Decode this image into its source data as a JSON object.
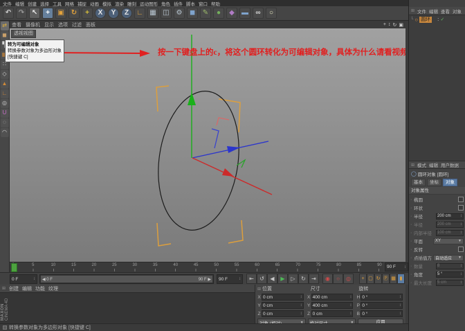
{
  "colors": {
    "axis_x_red": "#cc2a2a",
    "axis_y_green": "#19b019",
    "axis_z_blue": "#2b35cc",
    "selection_bracket_orange": "#dd9f3d",
    "annotation_red": "#e02020",
    "spline_black": "#1c1c1c",
    "active_tab_blue": "#5b7ca3",
    "play_green": "#4ca23e",
    "object_highlight_orange": "#c8873d"
  },
  "menubar": {
    "items": [
      "文件",
      "编辑",
      "创建",
      "选择",
      "工具",
      "网格",
      "捕捉",
      "动画",
      "模拟",
      "渲染",
      "雕刻",
      "运动图形",
      "角色",
      "插件",
      "脚本",
      "窗口",
      "帮助"
    ]
  },
  "toolbar": {
    "buttons": [
      {
        "name": "undo-button",
        "glyph": "↶",
        "color": "#cfcfcf"
      },
      {
        "name": "redo-button",
        "glyph": "↷",
        "color": "#9a9a9a"
      },
      {
        "name": "live-selection-button",
        "glyph": "↖",
        "color": "#f0f0f0",
        "bg": "#5f5f5f"
      },
      {
        "name": "move-button",
        "glyph": "+",
        "color": "#ffffff",
        "bg": "#66809c"
      },
      {
        "name": "scale-button",
        "glyph": "▣",
        "color": "#e2a23c"
      },
      {
        "name": "rotate-button",
        "glyph": "↻",
        "color": "#e2a23c"
      },
      {
        "name": "last-tool-button",
        "glyph": "+",
        "color": "#d8c03a"
      },
      {
        "name": "lock-x-button",
        "glyph": "X",
        "color": "#e8e8e8",
        "round": true
      },
      {
        "name": "lock-y-button",
        "glyph": "Y",
        "color": "#e8e8e8",
        "round": true
      },
      {
        "name": "lock-z-button",
        "glyph": "Z",
        "color": "#e8e8e8",
        "round": true
      },
      {
        "name": "coordinate-system-button",
        "glyph": "∟",
        "color": "#e2a23c"
      },
      {
        "name": "render-view-button",
        "glyph": "▦",
        "color": "#b9c7d2"
      },
      {
        "name": "render-region-button",
        "glyph": "◫",
        "color": "#b9c7d2"
      },
      {
        "name": "render-settings-button",
        "glyph": "⚙",
        "color": "#b9c7d2"
      },
      {
        "name": "primitive-cube-button",
        "glyph": "◼",
        "color": "#7fa3cc"
      },
      {
        "name": "spline-pen-button",
        "glyph": "✎",
        "color": "#9cba6a"
      },
      {
        "name": "subdivision-surface-button",
        "glyph": "●",
        "color": "#74b05c"
      },
      {
        "name": "deformer-button",
        "glyph": "◆",
        "color": "#b07cc5"
      },
      {
        "name": "floor-button",
        "glyph": "▬",
        "color": "#7fa3cc"
      },
      {
        "name": "camera-button",
        "glyph": "∞",
        "color": "#d9d9d9"
      },
      {
        "name": "light-button",
        "glyph": "○",
        "color": "#f3f3c9"
      }
    ]
  },
  "left_toolbar": {
    "buttons": [
      {
        "name": "convert-editable-button",
        "glyph": "⇄",
        "color": "#e2b13c",
        "bg": "#6b6b6b"
      },
      {
        "name": "model-mode-button",
        "glyph": "◼",
        "color": "#c9a06a"
      },
      {
        "name": "texture-mode-button",
        "glyph": "▚",
        "color": "#d8d8d8"
      },
      {
        "name": "workplane-mode-button",
        "glyph": "▦",
        "color": "#cf8a3a"
      },
      {
        "name": "points-mode-button",
        "glyph": "∷",
        "color": "#cfcfcf"
      },
      {
        "name": "edges-mode-button",
        "glyph": "◇",
        "color": "#cfcfcf"
      },
      {
        "name": "polygons-mode-button",
        "glyph": "▲",
        "color": "#cf8a3a"
      },
      {
        "name": "axis-mode-button",
        "glyph": "∟",
        "color": "#cf8a3a"
      },
      {
        "name": "solo-mode-button",
        "glyph": "◎",
        "color": "#cfcfcf"
      },
      {
        "name": "snap-button",
        "glyph": "U",
        "color": "#c86ec8"
      },
      {
        "name": "quantize-button",
        "glyph": "◌",
        "color": "#cfcfcf"
      },
      {
        "name": "workplane-snap-button",
        "glyph": "◠",
        "color": "#cfcfcf"
      }
    ]
  },
  "viewport": {
    "menu_items": [
      "查看",
      "摄像机",
      "显示",
      "选项",
      "过滤",
      "面板"
    ],
    "nav": [
      {
        "name": "pan-view-icon",
        "glyph": "+"
      },
      {
        "name": "zoom-view-icon",
        "glyph": "↕"
      },
      {
        "name": "rotate-view-icon",
        "glyph": "↻"
      },
      {
        "name": "toggle-view-icon",
        "glyph": "▣"
      }
    ],
    "view_label": "透视视图",
    "tooltip": {
      "title": "转为可编辑对象",
      "body": "转换参数对象为多边形对象",
      "shortcut": "[快捷键 C]"
    },
    "annotation": "按一下键盘上的c，将这个圆环转化为可编辑对象，具体为什么请看视频"
  },
  "timeline": {
    "ticks": [
      "0",
      "5",
      "10",
      "15",
      "20",
      "25",
      "30",
      "35",
      "40",
      "45",
      "50",
      "55",
      "60",
      "65",
      "70",
      "75",
      "80",
      "85",
      "90"
    ],
    "end_frame_top": "90 F",
    "current_frame": "0 F",
    "range_start": "0 F",
    "range_end": "90 F",
    "end_frame": "90 F",
    "transport": [
      {
        "name": "goto-start-button",
        "glyph": "⇤"
      },
      {
        "name": "previous-key-button",
        "glyph": "↺"
      },
      {
        "name": "previous-frame-button",
        "glyph": "◀"
      },
      {
        "name": "play-button",
        "glyph": "▶",
        "color": "#4dbb57"
      },
      {
        "name": "next-frame-button",
        "glyph": "▷"
      },
      {
        "name": "next-key-button",
        "glyph": "↻"
      },
      {
        "name": "goto-end-button",
        "glyph": "⇥"
      }
    ],
    "record": [
      {
        "name": "record-keyframe-button",
        "glyph": "◉"
      },
      {
        "name": "autokey-button",
        "glyph": "○"
      },
      {
        "name": "keyframe-selection-button",
        "glyph": "◎"
      }
    ],
    "key_toggles": [
      {
        "name": "key-position-button",
        "glyph": "+"
      },
      {
        "name": "key-scale-button",
        "glyph": "▢"
      },
      {
        "name": "key-rotation-button",
        "glyph": "↻"
      },
      {
        "name": "key-parameter-button",
        "glyph": "Ⓟ"
      },
      {
        "name": "key-pla-button",
        "glyph": "▦"
      },
      {
        "name": "keyframe-mode-button",
        "glyph": "▮",
        "bg": "#5b7ca3"
      }
    ]
  },
  "material_manager": {
    "menu_items": [
      "创建",
      "编辑",
      "功能",
      "纹理"
    ],
    "logo_top": "MAXON",
    "logo_bottom": "CINEMA 4D"
  },
  "coordinate_manager": {
    "headers": [
      "位置",
      "尺寸",
      "旋转"
    ],
    "rows": [
      {
        "pos_axis": "X",
        "pos": "0 cm",
        "size_axis": "X",
        "size": "400 cm",
        "rot_axis": "H",
        "rot": "0 °"
      },
      {
        "pos_axis": "Y",
        "pos": "0 cm",
        "size_axis": "Y",
        "size": "400 cm",
        "rot_axis": "P",
        "rot": "0 °"
      },
      {
        "pos_axis": "Z",
        "pos": "0 cm",
        "size_axis": "Z",
        "size": "0 cm",
        "rot_axis": "B",
        "rot": "0 °"
      }
    ],
    "mode_dropdown": "对象 (相对)",
    "size_dropdown": "绝对尺寸",
    "apply_label": "应用"
  },
  "status_bar": {
    "text": "转换参数对象为多边形对象 [快捷键 C]"
  },
  "object_manager": {
    "menu_items": [
      "文件",
      "编辑",
      "查看",
      "对象"
    ],
    "objects": [
      {
        "name": "圆环"
      }
    ]
  },
  "attribute_manager": {
    "menu_items": [
      "模式",
      "编辑",
      "用户数据"
    ],
    "title": "圆环对象 [圆环]",
    "tabs": [
      "基本",
      "坐标",
      "对象"
    ],
    "active_tab_index": 2,
    "section": "对象属性",
    "rows": [
      {
        "label": "椭圆",
        "type": "checkbox"
      },
      {
        "label": "环状",
        "type": "checkbox"
      },
      {
        "label": "半径",
        "type": "field",
        "value": "200 cm"
      },
      {
        "label": "半径",
        "type": "field",
        "value": "200 cm",
        "disabled": true
      },
      {
        "label": "内部半径",
        "type": "field",
        "value": "100 cm",
        "disabled": true
      },
      {
        "label": "平面",
        "type": "dropdown",
        "value": "XY"
      },
      {
        "label": "反转",
        "type": "checkbox"
      },
      {
        "label": "点插值方式",
        "type": "dropdown",
        "value": "自动适应"
      },
      {
        "label": "数量",
        "type": "field",
        "value": "8",
        "disabled": true
      },
      {
        "label": "角度",
        "type": "field",
        "value": "5 °"
      },
      {
        "label": "最大长度",
        "type": "field",
        "value": "5 cm",
        "disabled": true
      }
    ]
  }
}
